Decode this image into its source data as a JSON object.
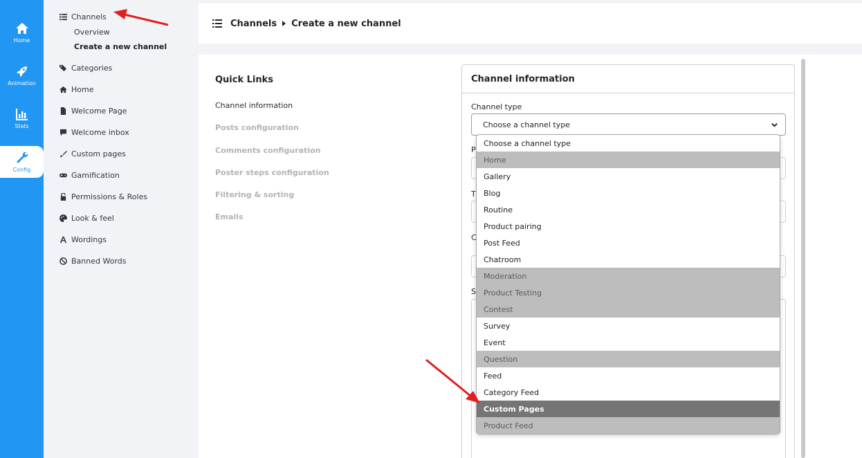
{
  "rail": [
    {
      "label": "Home",
      "icon": "home-icon"
    },
    {
      "label": "Animation",
      "icon": "rocket-icon"
    },
    {
      "label": "Stats",
      "icon": "bar-chart-icon"
    },
    {
      "label": "Config",
      "icon": "wrench-icon"
    }
  ],
  "menu": {
    "channels": "Channels",
    "overview": "Overview",
    "create": "Create a new channel",
    "items": [
      {
        "label": "Categories",
        "icon": "tags-icon"
      },
      {
        "label": "Home",
        "icon": "home-icon"
      },
      {
        "label": "Welcome Page",
        "icon": "file-icon"
      },
      {
        "label": "Welcome inbox",
        "icon": "comment-icon"
      },
      {
        "label": "Custom pages",
        "icon": "brush-icon"
      },
      {
        "label": "Gamification",
        "icon": "gamepad-icon"
      },
      {
        "label": "Permissions & Roles",
        "icon": "lock-icon"
      },
      {
        "label": "Look & feel",
        "icon": "palette-icon"
      },
      {
        "label": "Wordings",
        "icon": "font-icon"
      },
      {
        "label": "Banned Words",
        "icon": "ban-icon"
      }
    ]
  },
  "header": {
    "crumb1": "Channels",
    "crumb2": "Create a new channel"
  },
  "quick_links": {
    "title": "Quick Links",
    "links": [
      "Channel information",
      "Posts configuration",
      "Comments configuration",
      "Poster steps configuration",
      "Filtering & sorting",
      "Emails"
    ]
  },
  "card": {
    "title": "Channel information",
    "channel_type_label": "Channel type",
    "select_value": "Choose a channel type",
    "partial_labels": [
      "P",
      "T",
      "C",
      "S"
    ]
  },
  "dropdown": {
    "options": [
      {
        "label": "Choose a channel type",
        "state": "normal"
      },
      {
        "label": "Home",
        "state": "disabled"
      },
      {
        "label": "Gallery",
        "state": "normal"
      },
      {
        "label": "Blog",
        "state": "normal"
      },
      {
        "label": "Routine",
        "state": "normal"
      },
      {
        "label": "Product pairing",
        "state": "normal"
      },
      {
        "label": "Post Feed",
        "state": "normal"
      },
      {
        "label": "Chatroom",
        "state": "normal"
      },
      {
        "label": "Moderation",
        "state": "disabled"
      },
      {
        "label": "Product Testing",
        "state": "disabled"
      },
      {
        "label": "Contest",
        "state": "disabled"
      },
      {
        "label": "Survey",
        "state": "normal"
      },
      {
        "label": "Event",
        "state": "normal"
      },
      {
        "label": "Question",
        "state": "disabled"
      },
      {
        "label": "Feed",
        "state": "normal"
      },
      {
        "label": "Category Feed",
        "state": "normal"
      },
      {
        "label": "Custom Pages",
        "state": "selected"
      },
      {
        "label": "Product Feed",
        "state": "disabled"
      }
    ]
  },
  "colors": {
    "rail_blue": "#2196f3",
    "arrow_red": "#e02020",
    "selected_gray": "#757575",
    "disabled_gray": "#bdbdbd"
  }
}
